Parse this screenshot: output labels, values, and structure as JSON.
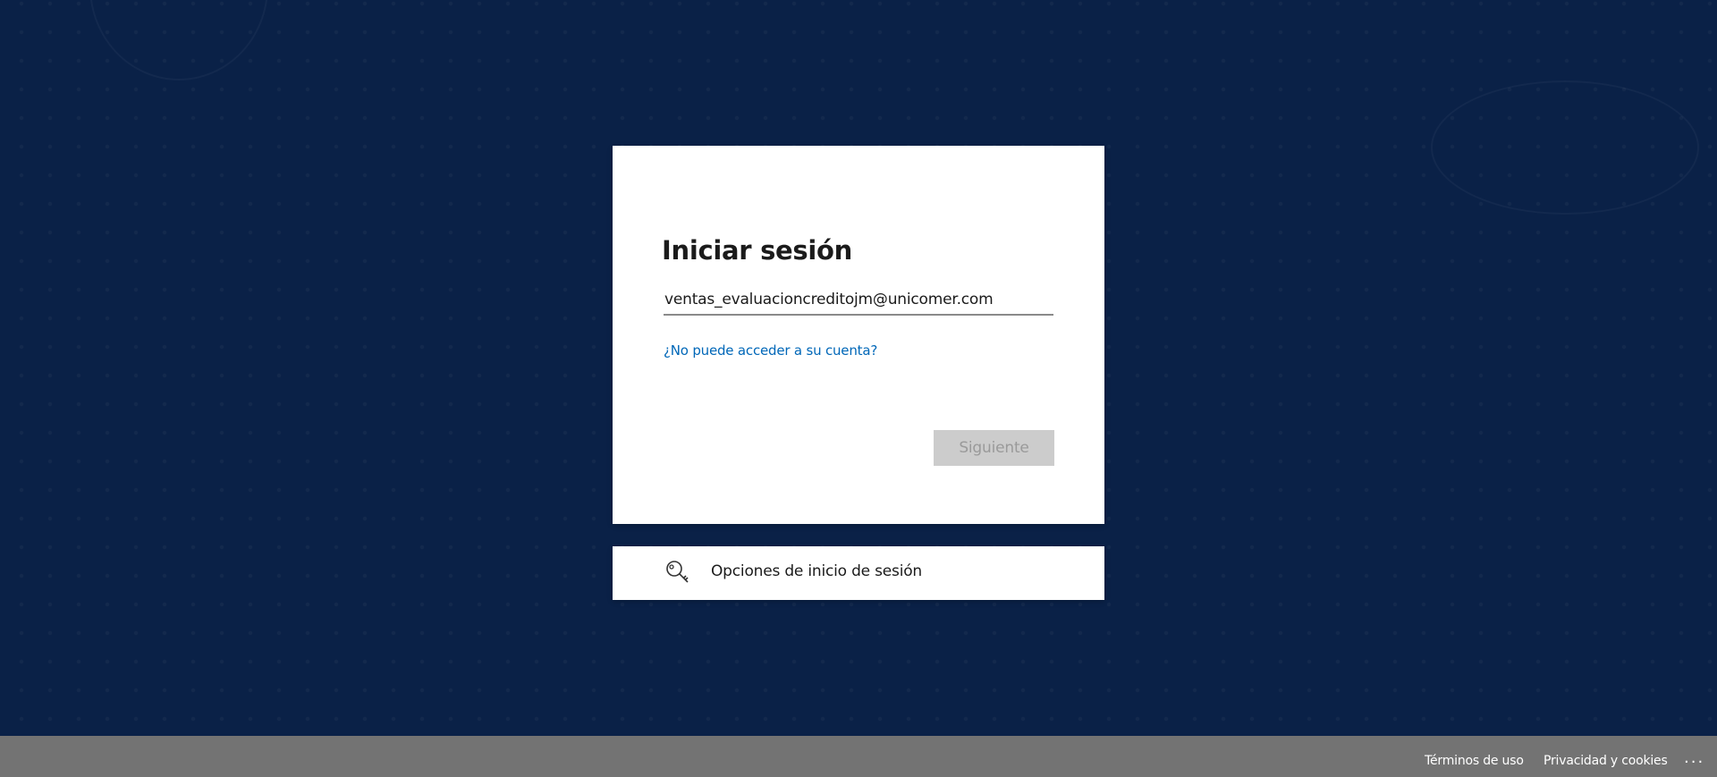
{
  "signin": {
    "title": "Iniciar sesión",
    "email_value": "ventas_evaluacioncreditojm@unicomer.com",
    "cant_access_link": "¿No puede acceder a su cuenta?",
    "next_button": "Siguiente"
  },
  "options": {
    "icon": "key-search-icon",
    "label": "Opciones de inicio de sesión"
  },
  "footer": {
    "terms": "Términos de uso",
    "privacy": "Privacidad y cookies",
    "more": "..."
  },
  "colors": {
    "background": "#0a2147",
    "link": "#0067b8",
    "footer": "#737373",
    "button_disabled": "#cccccc"
  }
}
